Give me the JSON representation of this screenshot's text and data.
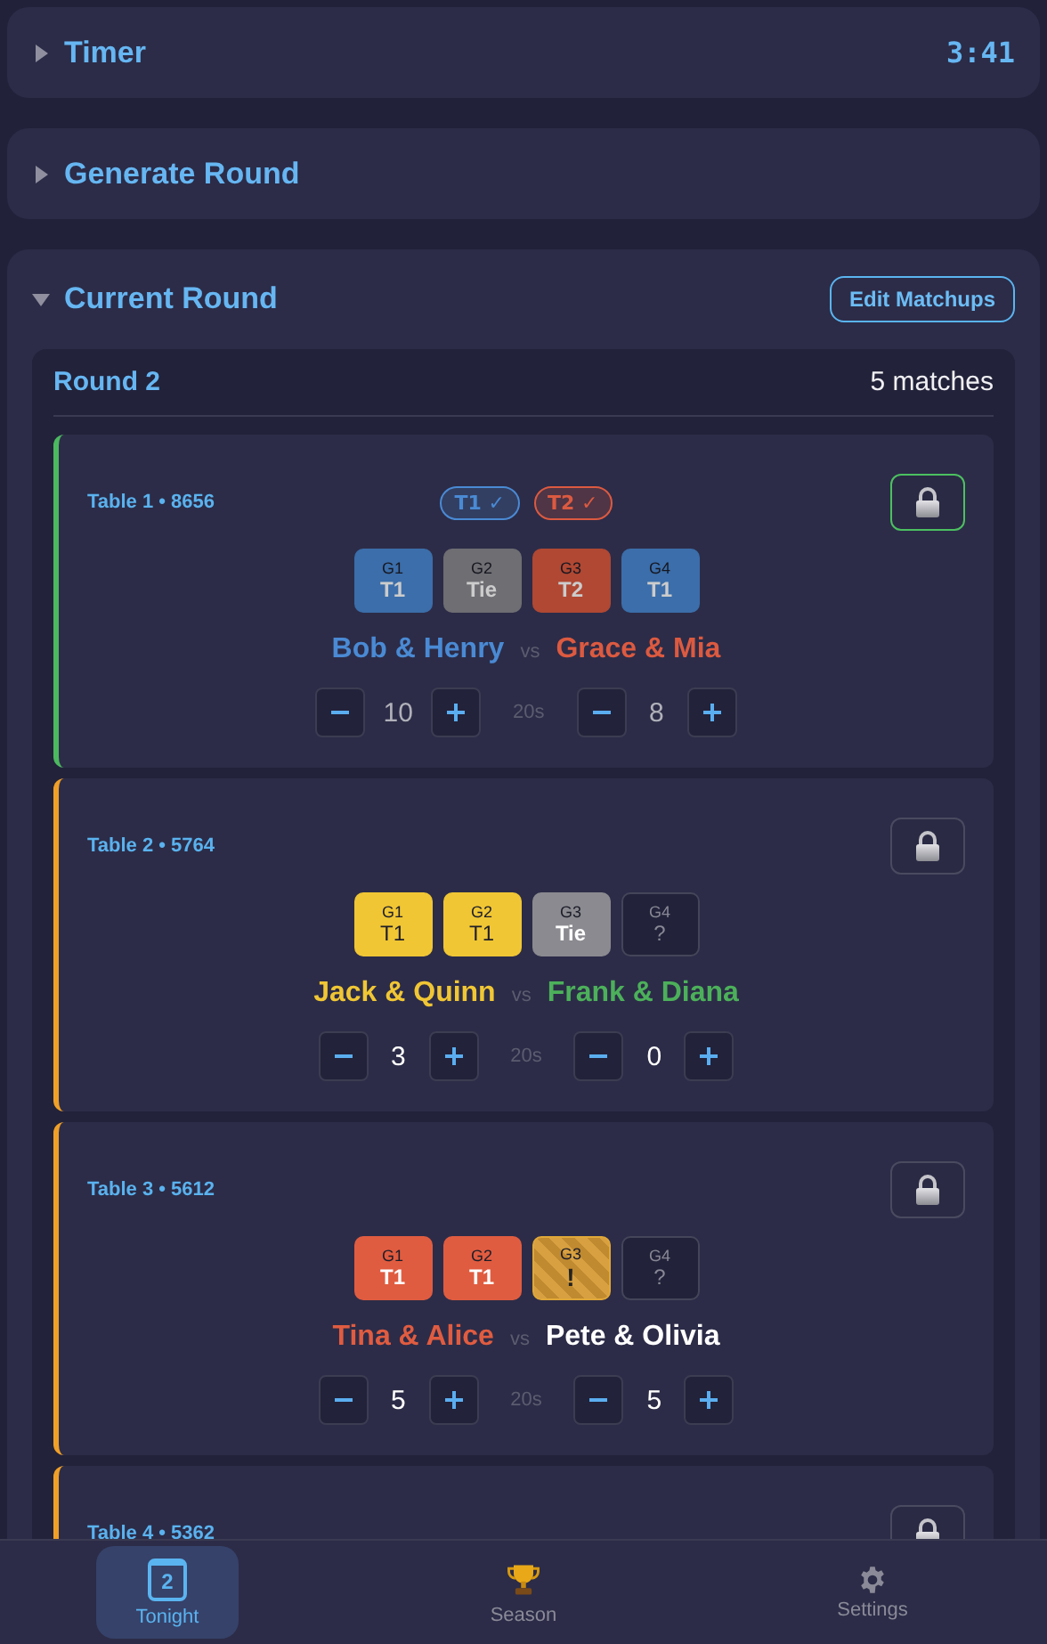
{
  "timer": {
    "title": "Timer",
    "expanded": false,
    "time": "3:41"
  },
  "generate": {
    "title": "Generate Round",
    "expanded": false
  },
  "current": {
    "title": "Current Round",
    "expanded": true,
    "edit_button": "Edit Matchups",
    "round": "Round 2",
    "count": "5 matches",
    "matches": [
      {
        "table": "Table 1 • 8656",
        "locked": true,
        "confirmations": [
          {
            "label": "T1 ✓",
            "kind": "t1"
          },
          {
            "label": "T2 ✓",
            "kind": "t2"
          }
        ],
        "games": [
          {
            "label": "G1",
            "result": "T1",
            "kind": "t1"
          },
          {
            "label": "G2",
            "result": "Tie",
            "kind": "tie"
          },
          {
            "label": "G3",
            "result": "T2",
            "kind": "t2"
          },
          {
            "label": "G4",
            "result": "T1",
            "kind": "t1"
          }
        ],
        "team1": {
          "name": "Bob & Henry",
          "color": "#4a8ad4",
          "score": "10"
        },
        "vs": "vs",
        "time": "20s",
        "team2": {
          "name": "Grace & Mia",
          "color": "#dc5a40",
          "score": "8"
        }
      },
      {
        "table": "Table 2 • 5764",
        "locked": false,
        "games": [
          {
            "label": "G1",
            "result": "T1",
            "kind": "t1"
          },
          {
            "label": "G2",
            "result": "T1",
            "kind": "t1"
          },
          {
            "label": "G3",
            "result": "Tie",
            "kind": "tie"
          },
          {
            "label": "G4",
            "result": "?",
            "kind": "pending"
          }
        ],
        "team1": {
          "name": "Jack & Quinn",
          "color": "#f0c634",
          "score": "3"
        },
        "vs": "vs",
        "time": "20s",
        "team2": {
          "name": "Frank & Diana",
          "color": "#4cb05a",
          "score": "0"
        }
      },
      {
        "table": "Table 3 • 5612",
        "locked": false,
        "games": [
          {
            "label": "G1",
            "result": "T1",
            "kind": "t1"
          },
          {
            "label": "G2",
            "result": "T1",
            "kind": "t1"
          },
          {
            "label": "G3",
            "result": "!",
            "kind": "disputed"
          },
          {
            "label": "G4",
            "result": "?",
            "kind": "pending"
          }
        ],
        "team1": {
          "name": "Tina & Alice",
          "color": "#e05c40",
          "score": "5"
        },
        "vs": "vs",
        "time": "20s",
        "team2": {
          "name": "Pete & Olivia",
          "color": "#ffffff",
          "score": "5"
        }
      },
      {
        "table": "Table 4 • 5362",
        "locked": false
      }
    ]
  },
  "nav": [
    {
      "label": "Tonight",
      "kind": "calendar",
      "icon_text": "2",
      "selected": true
    },
    {
      "label": "Season",
      "kind": "trophy",
      "selected": false
    },
    {
      "label": "Settings",
      "kind": "gear",
      "selected": false
    }
  ]
}
